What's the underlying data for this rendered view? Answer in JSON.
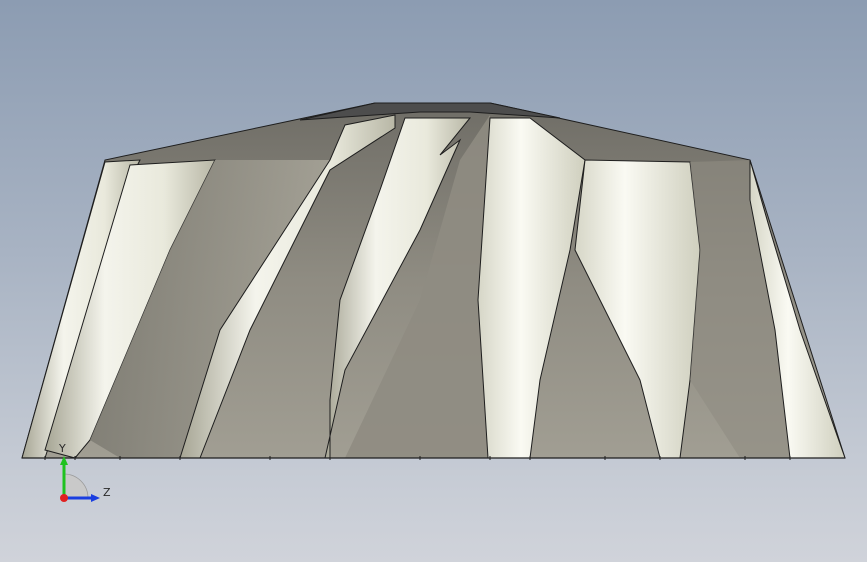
{
  "viewport": {
    "background_top": "#8c9cb2",
    "background_bottom": "#d0d3da"
  },
  "model": {
    "type": "impeller",
    "blade_count": 9,
    "colors": {
      "hub_surface": "#8f8c82",
      "blade_light": "#f3f3ea",
      "blade_shade": "#9b9a8c",
      "top_face": "#4d4d4d",
      "edge": "#1e1e1e"
    }
  },
  "triad": {
    "icon": "coordinate-triad-icon",
    "y_label": "Y",
    "z_label": "Z",
    "y_color": "#1fc21f",
    "z_color": "#1a3ee0",
    "origin_color": "#e02020"
  }
}
